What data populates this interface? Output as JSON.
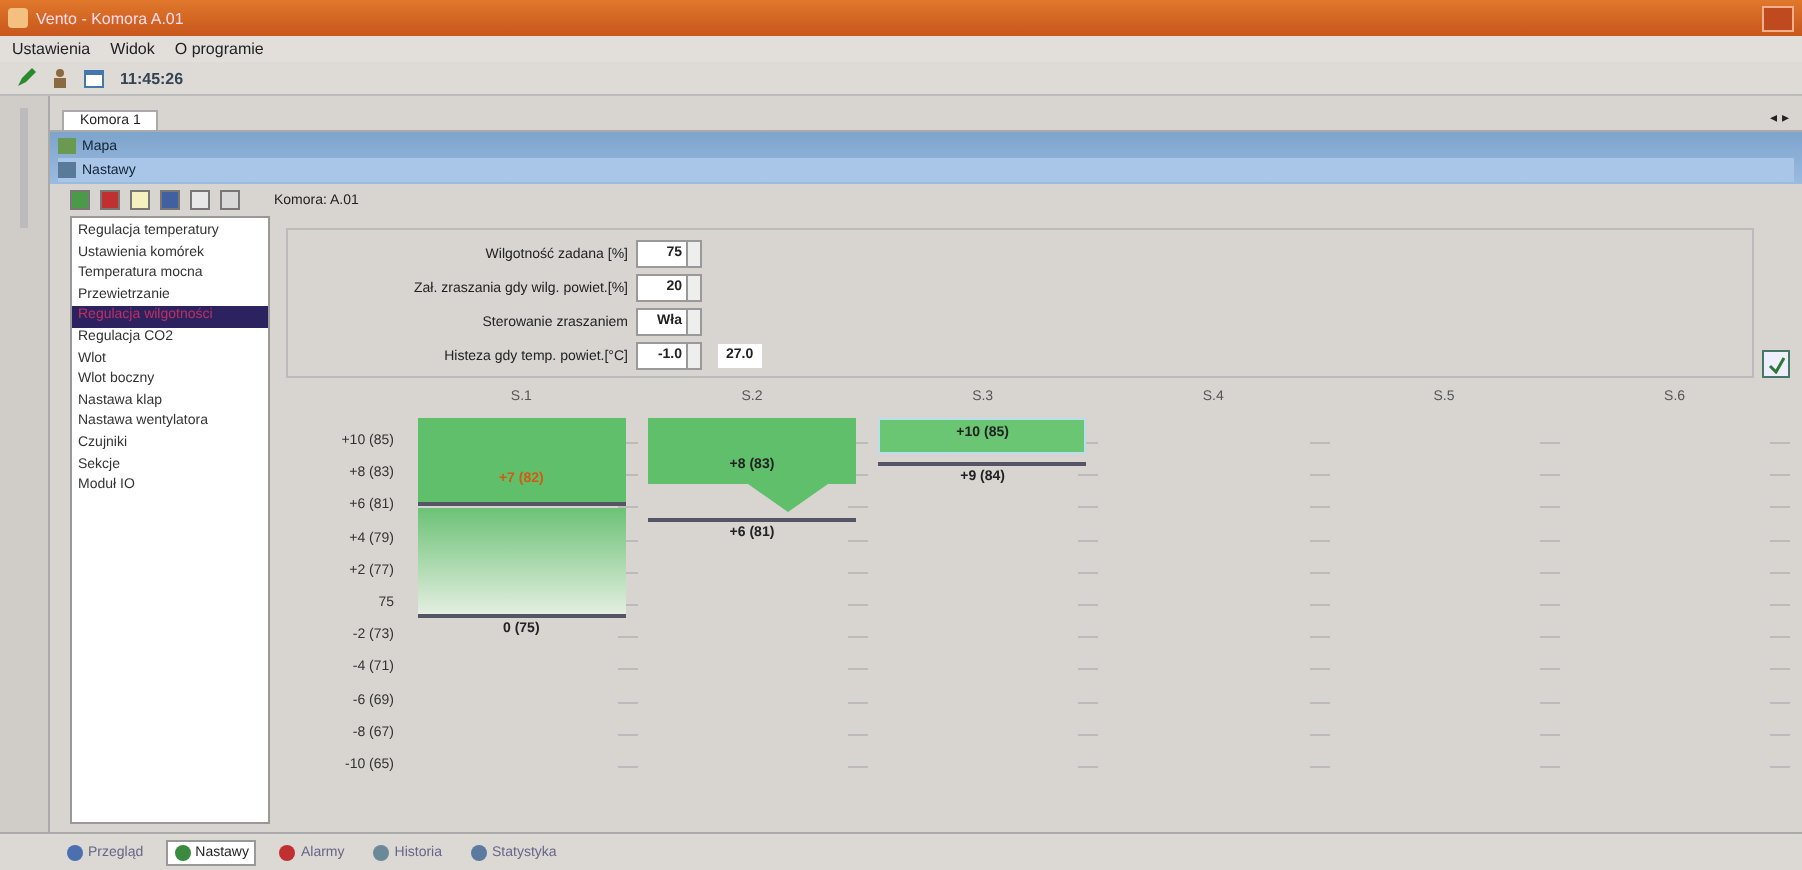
{
  "window": {
    "title": "Vento - Komora A.01"
  },
  "menu": [
    "Ustawienia",
    "Widok",
    "O programie"
  ],
  "toolbar": {
    "time": "11:45:26"
  },
  "tabs": [
    {
      "label": "Komora 1",
      "selected": true
    }
  ],
  "tab_arrows": "◂ ▸",
  "nav": [
    {
      "label": "Mapa",
      "selected": false
    },
    {
      "label": "Nastawy",
      "selected": true
    }
  ],
  "chamber": "Komora: A.01",
  "sidebar": {
    "items": [
      {
        "label": "Regulacja temperatury",
        "selected": false
      },
      {
        "label": "Ustawienia komórek",
        "selected": false
      },
      {
        "label": "Temperatura mocna",
        "selected": false
      },
      {
        "label": "Przewietrzanie",
        "selected": false
      },
      {
        "label": "Regulacja wilgotności",
        "selected": true
      },
      {
        "label": "Regulacja CO2",
        "selected": false
      },
      {
        "label": "Wlot",
        "selected": false
      },
      {
        "label": "Wlot boczny",
        "selected": false
      },
      {
        "label": "Nastawa klap",
        "selected": false
      },
      {
        "label": "Nastawa wentylatora",
        "selected": false
      },
      {
        "label": "Czujniki",
        "selected": false
      },
      {
        "label": "Sekcje",
        "selected": false
      },
      {
        "label": "Moduł IO",
        "selected": false
      }
    ]
  },
  "form": [
    {
      "label": "Wilgotność zadana [%]",
      "value": "75"
    },
    {
      "label": "Zał. zraszania gdy wilg. powiet.[%]",
      "value": "20"
    },
    {
      "label": "Sterowanie zraszaniem",
      "value": "Wła"
    },
    {
      "label": "Histeza gdy temp. powiet.[°C]",
      "value": "-1.0",
      "extra": "27.0"
    }
  ],
  "chart": {
    "y_labels": [
      "+10 (85)",
      "+8 (83)",
      "+6 (81)",
      "+4 (79)",
      "+2 (77)",
      "75",
      "-2 (73)",
      "-4 (71)",
      "-6 (69)",
      "-8 (67)",
      "-10 (65)"
    ],
    "columns": [
      {
        "name": "S.1",
        "kind": "full",
        "upper": "+7 (82)",
        "upper_alert": true,
        "lower": "0 (75)"
      },
      {
        "name": "S.2",
        "kind": "wedge",
        "upper": "+8 (83)",
        "upper_alert": false,
        "lower": "+6 (81)"
      },
      {
        "name": "S.3",
        "kind": "band",
        "upper": "+10 (85)",
        "upper_alert": false,
        "lower": "+9 (84)"
      },
      {
        "name": "S.4",
        "kind": "empty"
      },
      {
        "name": "S.5",
        "kind": "empty"
      },
      {
        "name": "S.6",
        "kind": "empty"
      }
    ]
  },
  "status_tabs": [
    {
      "label": "Przegląd",
      "selected": false
    },
    {
      "label": "Nastawy",
      "selected": true
    },
    {
      "label": "Alarmy",
      "selected": false
    },
    {
      "label": "Historia",
      "selected": false
    },
    {
      "label": "Statystyka",
      "selected": false
    }
  ]
}
